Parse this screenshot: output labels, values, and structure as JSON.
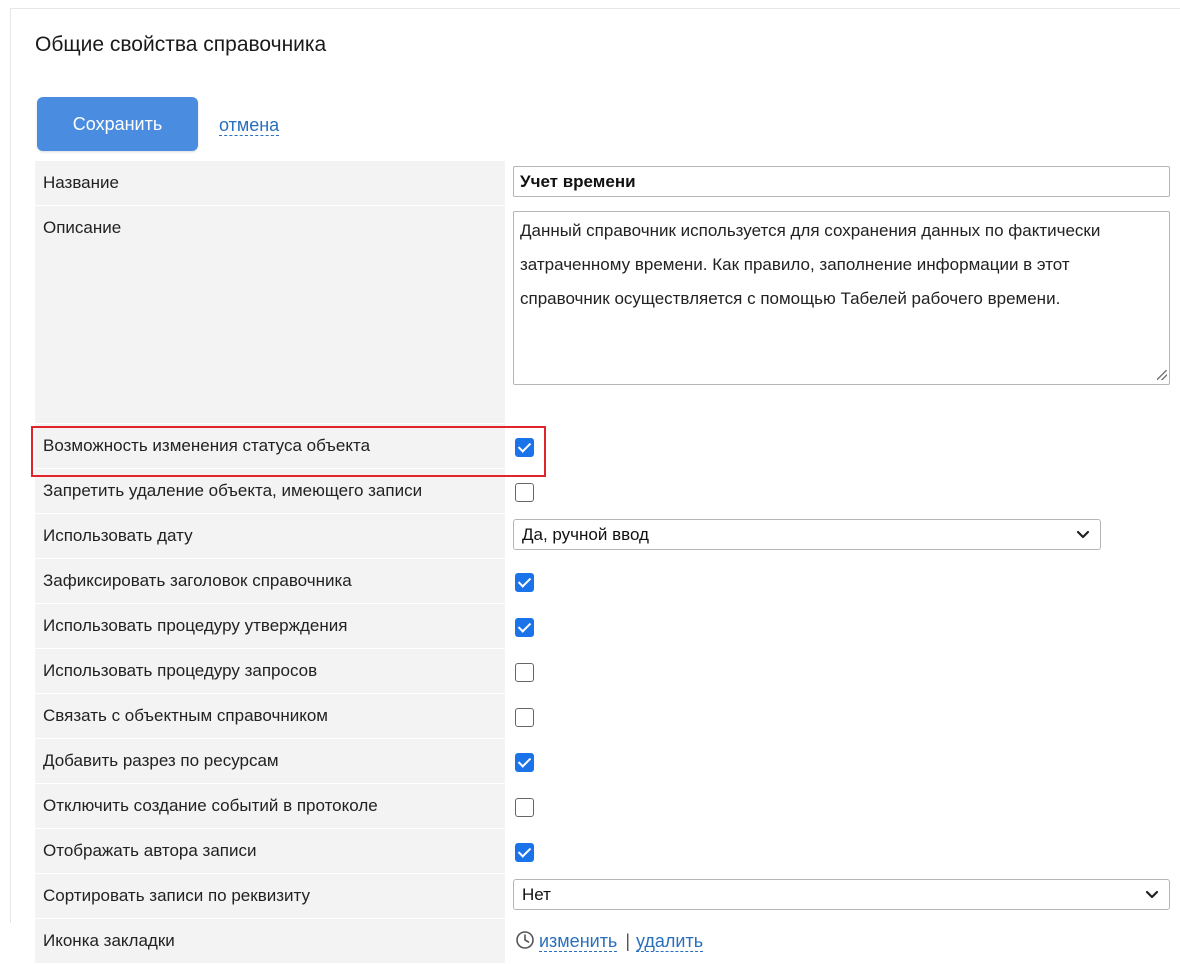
{
  "header": {
    "title": "Общие свойства справочника"
  },
  "actions": {
    "save_label": "Сохранить",
    "cancel_label": "отмена"
  },
  "fields": {
    "name": {
      "label": "Название",
      "value": "Учет времени"
    },
    "description": {
      "label": "Описание",
      "value": "Данный справочник используется для сохранения данных по фактически затраченному времени. Как правило, заполнение информации в этот справочник осуществляется с помощью Табелей рабочего времени."
    },
    "allow_status_change": {
      "label": "Возможность изменения статуса объекта",
      "checked": true
    },
    "forbid_delete": {
      "label": "Запретить удаление объекта, имеющего записи",
      "checked": false
    },
    "use_date": {
      "label": "Использовать дату",
      "selected": "Да, ручной ввод"
    },
    "fix_header": {
      "label": "Зафиксировать заголовок справочника",
      "checked": true
    },
    "use_approval": {
      "label": "Использовать процедуру утверждения",
      "checked": true
    },
    "use_requests": {
      "label": "Использовать процедуру запросов",
      "checked": false
    },
    "link_object_ref": {
      "label": "Связать с объектным справочником",
      "checked": false
    },
    "add_resource_slice": {
      "label": "Добавить разрез по ресурсам",
      "checked": true
    },
    "disable_log_events": {
      "label": "Отключить создание событий в протоколе",
      "checked": false
    },
    "show_author": {
      "label": "Отображать автора записи",
      "checked": true
    },
    "sort_by_attr": {
      "label": "Сортировать записи по реквизиту",
      "selected": "Нет"
    },
    "tab_icon": {
      "label": "Иконка закладки",
      "change_label": "изменить",
      "separator": "|",
      "delete_label": "удалить"
    }
  },
  "colors": {
    "primary": "#4a8de0",
    "checkbox": "#1a73e8",
    "link": "#2a6fbd",
    "highlight": "#e0242b",
    "label_bg": "#f3f3f3"
  }
}
